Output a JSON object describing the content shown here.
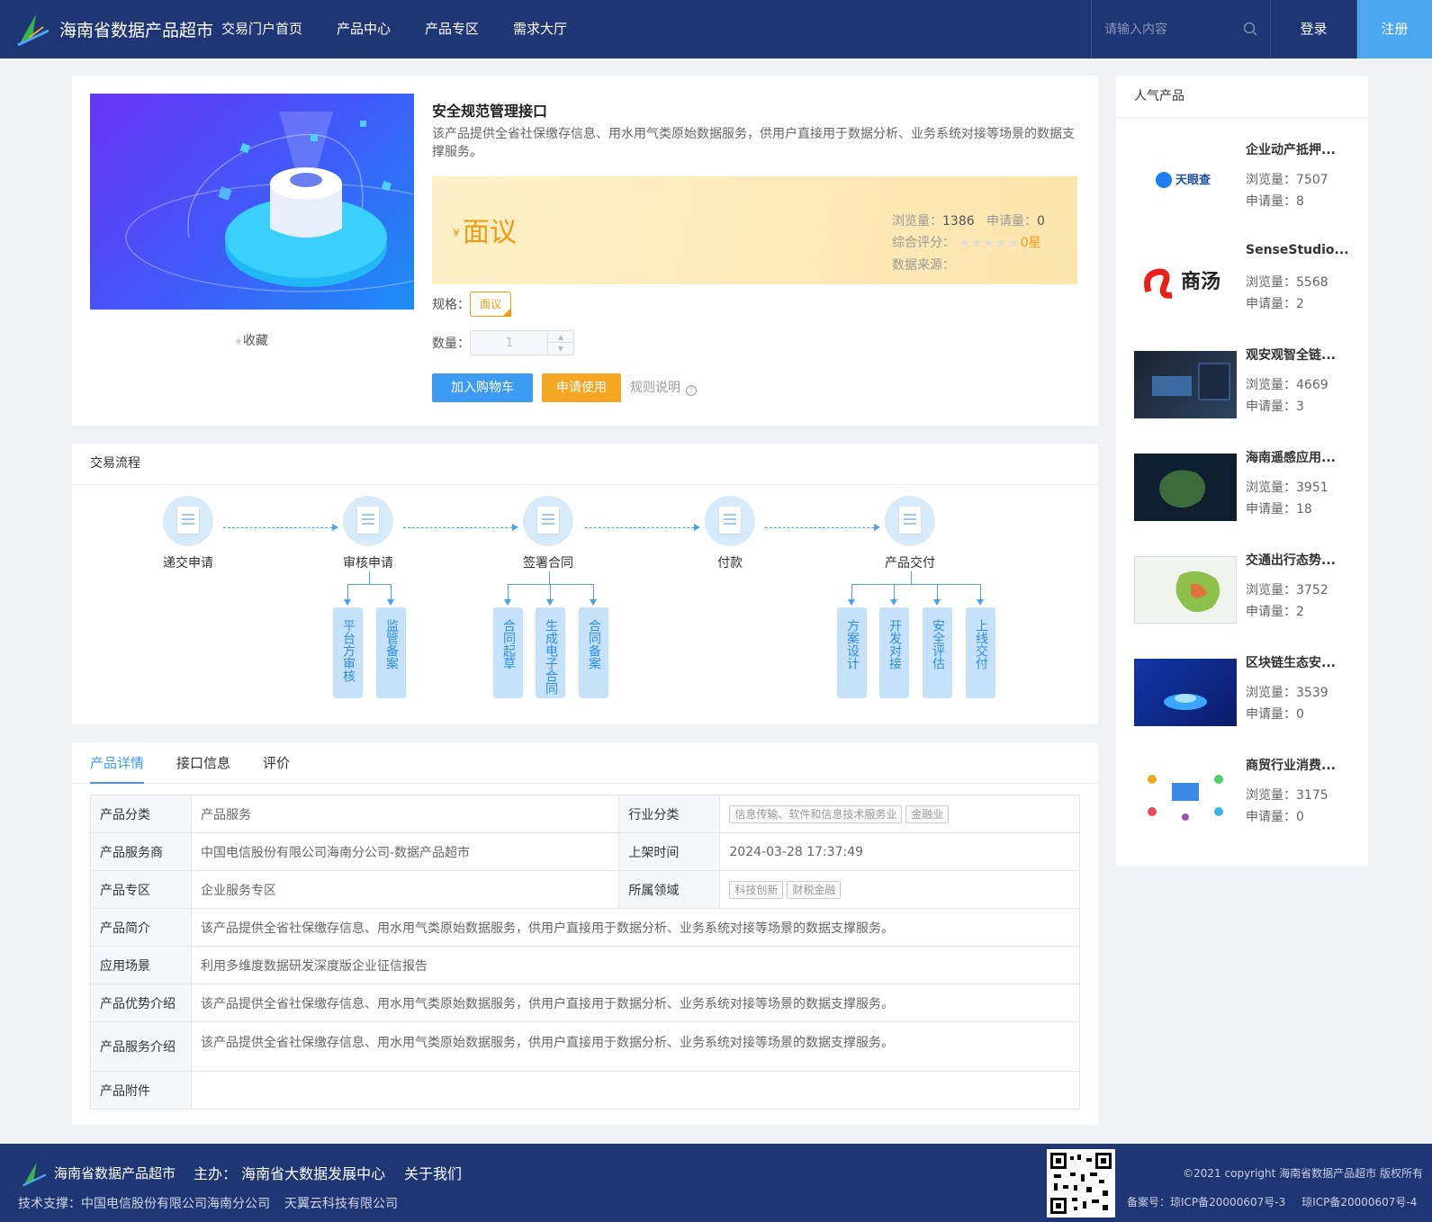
{
  "header": {
    "site_title": "海南省数据产品超市",
    "nav": [
      "交易门户首页",
      "产品中心",
      "产品专区",
      "需求大厅"
    ],
    "search_placeholder": "请输入内容",
    "login": "登录",
    "register": "注册"
  },
  "product": {
    "title": "安全规范管理接口",
    "description": "该产品提供全省社保缴存信息、用水用气类原始数据服务，供用户直接用于数据分析、业务系统对接等场景的数据支撑服务。",
    "price_symbol": "¥",
    "price": "面议",
    "views_label": "浏览量：",
    "views": "1386",
    "applies_label": "申请量：",
    "applies": "0",
    "rating_label": "综合评分：",
    "rating_stars": 0,
    "rating_text": "0星",
    "source_label": "数据来源：",
    "source": "",
    "favorite": "收藏",
    "spec_label": "规格：",
    "spec_value": "面议",
    "qty_label": "数量：",
    "qty_value": "1",
    "add_cart": "加入购物车",
    "apply": "申请使用",
    "rules": "规则说明"
  },
  "flow": {
    "title": "交易流程",
    "steps": [
      "递交申请",
      "审核申请",
      "签署合同",
      "付款",
      "产品交付"
    ],
    "sub_review": [
      "平台方审核",
      "监管备案"
    ],
    "sub_contract": [
      "合同起草",
      "生成电子合同",
      "合同备案"
    ],
    "sub_delivery": [
      "方案设计",
      "开发对接",
      "安全评估",
      "上线交付"
    ]
  },
  "detail": {
    "tabs": [
      "产品详情",
      "接口信息",
      "评价"
    ],
    "rows": {
      "category_k": "产品分类",
      "category_v": "产品服务",
      "industry_k": "行业分类",
      "industry_tags": [
        "信息传输、软件和信息技术服务业",
        "金融业"
      ],
      "provider_k": "产品服务商",
      "provider_v": "中国电信股份有限公司海南分公司-数据产品超市",
      "listed_k": "上架时间",
      "listed_v": "2024-03-28 17:37:49",
      "zone_k": "产品专区",
      "zone_v": "企业服务专区",
      "domain_k": "所属领域",
      "domain_tags": [
        "科技创新",
        "财税金融"
      ],
      "intro_k": "产品简介",
      "intro_v": "该产品提供全省社保缴存信息、用水用气类原始数据服务，供用户直接用于数据分析、业务系统对接等场景的数据支撑服务。",
      "scene_k": "应用场景",
      "scene_v": "利用多维度数据研发深度版企业征信报告",
      "adv_k": "产品优势介绍",
      "adv_v": "该产品提供全省社保缴存信息、用水用气类原始数据服务，供用户直接用于数据分析、业务系统对接等场景的数据支撑服务。",
      "svc_k": "产品服务介绍",
      "svc_v": "该产品提供全省社保缴存信息、用水用气类原始数据服务，供用户直接用于数据分析、业务系统对接等场景的数据支撑服务。",
      "att_k": "产品附件",
      "att_v": ""
    }
  },
  "sidebar": {
    "title": "人气产品",
    "views_label": "浏览量：",
    "applies_label": "申请量：",
    "items": [
      {
        "title": "企业动产抵押...",
        "views": "7507",
        "applies": "8",
        "thumb_text": "天眼查"
      },
      {
        "title": "SenseStudio...",
        "views": "5568",
        "applies": "2",
        "thumb_text": "商汤"
      },
      {
        "title": "观安观智全链...",
        "views": "4669",
        "applies": "3",
        "thumb_text": ""
      },
      {
        "title": "海南遥感应用...",
        "views": "3951",
        "applies": "18",
        "thumb_text": ""
      },
      {
        "title": "交通出行态势...",
        "views": "3752",
        "applies": "2",
        "thumb_text": ""
      },
      {
        "title": "区块链生态安...",
        "views": "3539",
        "applies": "0",
        "thumb_text": ""
      },
      {
        "title": "商贸行业消费...",
        "views": "3175",
        "applies": "0",
        "thumb_text": ""
      }
    ]
  },
  "footer": {
    "title": "海南省数据产品超市",
    "host": "主办： 海南省大数据发展中心",
    "about": "关于我们",
    "tech_label": "技术支撑：中国电信股份有限公司海南分公司",
    "tech_2": "天翼云科技有限公司",
    "copyright": "©2021 copyright 海南省数据产品超市 版权所有",
    "icp_1": "备案号：琼ICP备20000607号-3",
    "icp_2": "琼ICP备20000607号-4"
  }
}
